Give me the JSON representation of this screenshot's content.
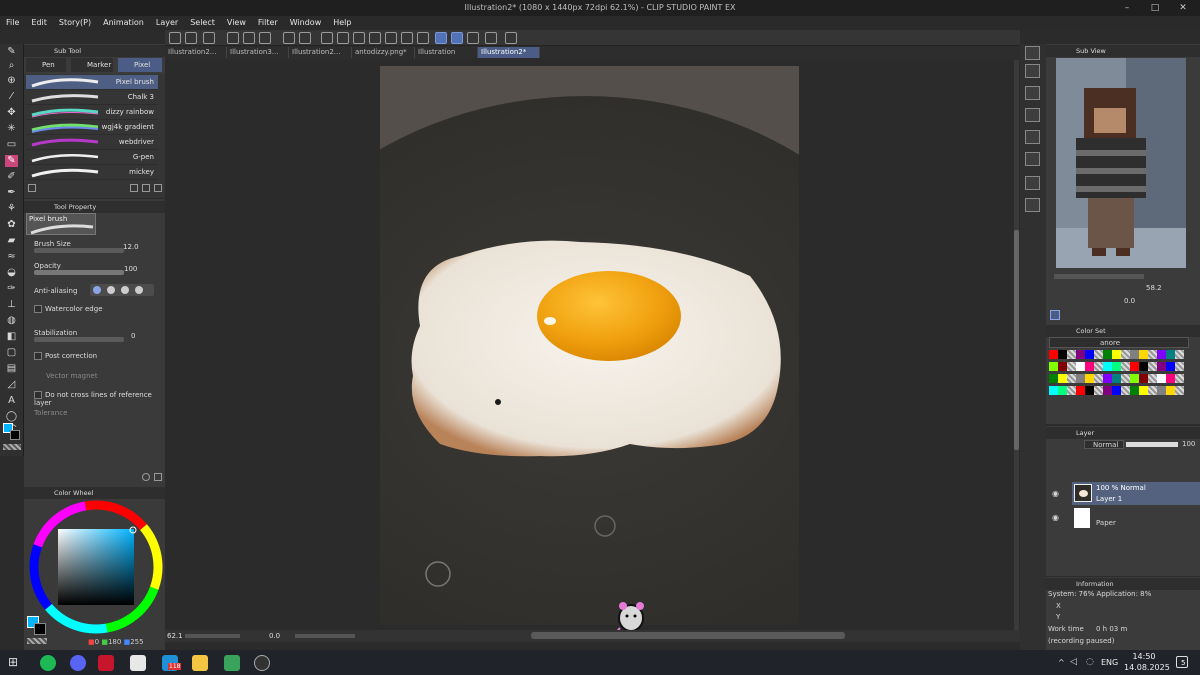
{
  "window": {
    "title": "Illustration2* (1080 x 1440px 72dpi 62.1%) - CLIP STUDIO PAINT EX"
  },
  "menu": [
    "File",
    "Edit",
    "Story(P)",
    "Animation",
    "Layer",
    "Select",
    "View",
    "Filter",
    "Window",
    "Help"
  ],
  "tabs": [
    {
      "label": "Illustration2..."
    },
    {
      "label": "Illustration3..."
    },
    {
      "label": "Illustration2..."
    },
    {
      "label": "antodizzy.png*"
    },
    {
      "label": "Illustration"
    },
    {
      "label": "Illustration2*"
    }
  ],
  "subtool": {
    "header": "Sub Tool",
    "groups": [
      "Pen",
      "Marker",
      "Pixel bru"
    ],
    "brushes": [
      "Pixel brush",
      "Chalk 3",
      "dizzy rainbow",
      "wgj4k gradient",
      "webdriver",
      "G-pen",
      "mickey"
    ]
  },
  "toolprop": {
    "header": "Tool Property",
    "preview_label": "Pixel brush",
    "brush_size_label": "Brush Size",
    "brush_size_value": "12.0",
    "opacity_label": "Opacity",
    "opacity_value": "100",
    "antialiasing_label": "Anti-aliasing",
    "watercolor_label": "Watercolor edge",
    "stabilization_label": "Stabilization",
    "stabilization_value": "0",
    "postcorrection_label": "Post correction",
    "vectormagnet_label": "Vector magnet",
    "donotcross_label": "Do not cross lines of reference layer",
    "tolerance_label": "Tolerance"
  },
  "colorwheel": {
    "header": "Color Wheel",
    "values": "0 180 255",
    "v1": "0",
    "v2": "180",
    "v3": "255",
    "main_color": "#00b4ff"
  },
  "status": {
    "zoom": "62.1",
    "rotation": "0.0"
  },
  "subview": {
    "header": "Sub View",
    "zoom": "58.2",
    "rotation": "0.0"
  },
  "colorset": {
    "header": "Color Set",
    "set_name": "anore"
  },
  "layer": {
    "header": "Layer",
    "blend_mode": "Normal",
    "opacity": "100",
    "items": [
      {
        "line1": "100 % Normal",
        "line2": "Layer 1"
      },
      {
        "line1": "",
        "line2": "Paper"
      }
    ]
  },
  "info": {
    "header": "Information",
    "system": "System: 76% Application: 8%",
    "x": "X",
    "y": "Y",
    "worktime_label": "Work time",
    "worktime_value": "0 h 03 m",
    "recording": "(recording paused)"
  },
  "taskbar": {
    "lang": "ENG",
    "time": "14:50",
    "date": "14.08.2025",
    "badge": "5",
    "app_badge": "118"
  }
}
